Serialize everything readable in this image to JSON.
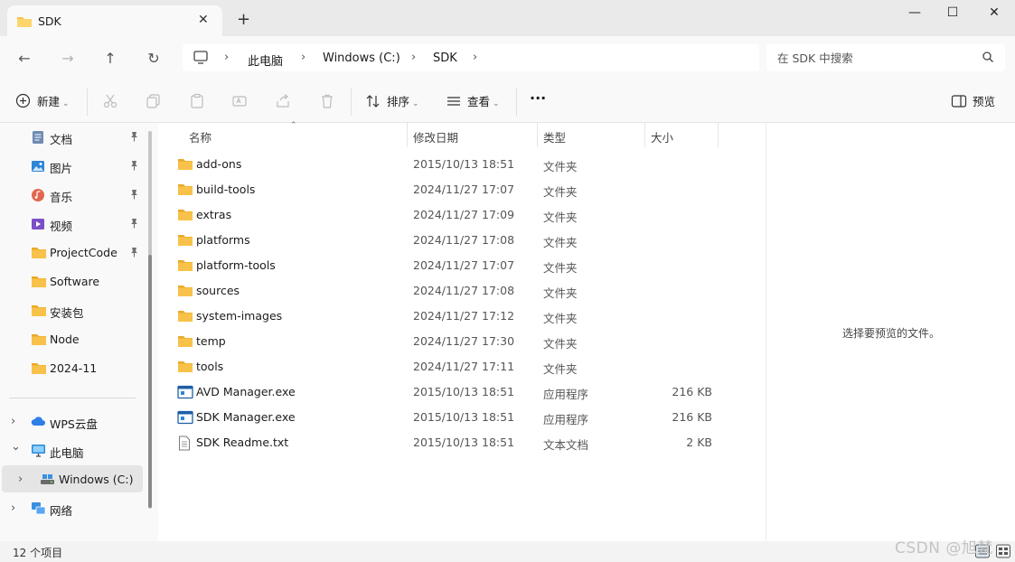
{
  "window": {
    "tab_title": "SDK",
    "tab_close": "✕",
    "new_tab": "+",
    "minimize": "—",
    "maximize": "☐",
    "close": "✕"
  },
  "nav": {
    "breadcrumbs": [
      "此电脑",
      "Windows (C:)",
      "SDK"
    ],
    "search_placeholder": "在 SDK 中搜索"
  },
  "toolbar": {
    "new_label": "新建",
    "sort_label": "排序",
    "view_label": "查看",
    "more_label": "···",
    "preview_label": "预览"
  },
  "sidebar": {
    "quick_access": [
      {
        "label": "文档",
        "icon": "document-icon",
        "pinned": true
      },
      {
        "label": "图片",
        "icon": "pictures-icon",
        "pinned": true
      },
      {
        "label": "音乐",
        "icon": "music-icon",
        "pinned": true
      },
      {
        "label": "视频",
        "icon": "video-icon",
        "pinned": true
      },
      {
        "label": "ProjectCode",
        "icon": "folder-icon",
        "pinned": true
      },
      {
        "label": "Software",
        "icon": "folder-icon",
        "pinned": false
      },
      {
        "label": "安装包",
        "icon": "folder-icon",
        "pinned": false
      },
      {
        "label": "Node",
        "icon": "folder-icon",
        "pinned": false
      },
      {
        "label": "2024-11",
        "icon": "folder-icon",
        "pinned": false
      }
    ],
    "tree": [
      {
        "label": "WPS云盘",
        "icon": "cloud-icon",
        "chevron": "›"
      },
      {
        "label": "此电脑",
        "icon": "computer-icon",
        "chevron": "⌄"
      },
      {
        "label": "Windows (C:)",
        "icon": "drive-icon",
        "chevron": "›"
      },
      {
        "label": "网络",
        "icon": "network-icon",
        "chevron": "›"
      }
    ]
  },
  "columns": {
    "name": "名称",
    "date": "修改日期",
    "type": "类型",
    "size": "大小"
  },
  "files": [
    {
      "name": "add-ons",
      "date": "2015/10/13 18:51",
      "type": "文件夹",
      "size": "",
      "kind": "folder"
    },
    {
      "name": "build-tools",
      "date": "2024/11/27 17:07",
      "type": "文件夹",
      "size": "",
      "kind": "folder"
    },
    {
      "name": "extras",
      "date": "2024/11/27 17:09",
      "type": "文件夹",
      "size": "",
      "kind": "folder"
    },
    {
      "name": "platforms",
      "date": "2024/11/27 17:08",
      "type": "文件夹",
      "size": "",
      "kind": "folder"
    },
    {
      "name": "platform-tools",
      "date": "2024/11/27 17:07",
      "type": "文件夹",
      "size": "",
      "kind": "folder"
    },
    {
      "name": "sources",
      "date": "2024/11/27 17:08",
      "type": "文件夹",
      "size": "",
      "kind": "folder"
    },
    {
      "name": "system-images",
      "date": "2024/11/27 17:12",
      "type": "文件夹",
      "size": "",
      "kind": "folder"
    },
    {
      "name": "temp",
      "date": "2024/11/27 17:30",
      "type": "文件夹",
      "size": "",
      "kind": "folder"
    },
    {
      "name": "tools",
      "date": "2024/11/27 17:11",
      "type": "文件夹",
      "size": "",
      "kind": "folder"
    },
    {
      "name": "AVD Manager.exe",
      "date": "2015/10/13 18:51",
      "type": "应用程序",
      "size": "216 KB",
      "kind": "exe"
    },
    {
      "name": "SDK Manager.exe",
      "date": "2015/10/13 18:51",
      "type": "应用程序",
      "size": "216 KB",
      "kind": "exe"
    },
    {
      "name": "SDK Readme.txt",
      "date": "2015/10/13 18:51",
      "type": "文本文档",
      "size": "2 KB",
      "kind": "txt"
    }
  ],
  "preview": {
    "message": "选择要预览的文件。"
  },
  "status": {
    "item_count": "12 个项目"
  },
  "watermark": "CSDN @旭梵",
  "colors": {
    "folder": "#f8c24a",
    "accent": "#0067c0"
  }
}
